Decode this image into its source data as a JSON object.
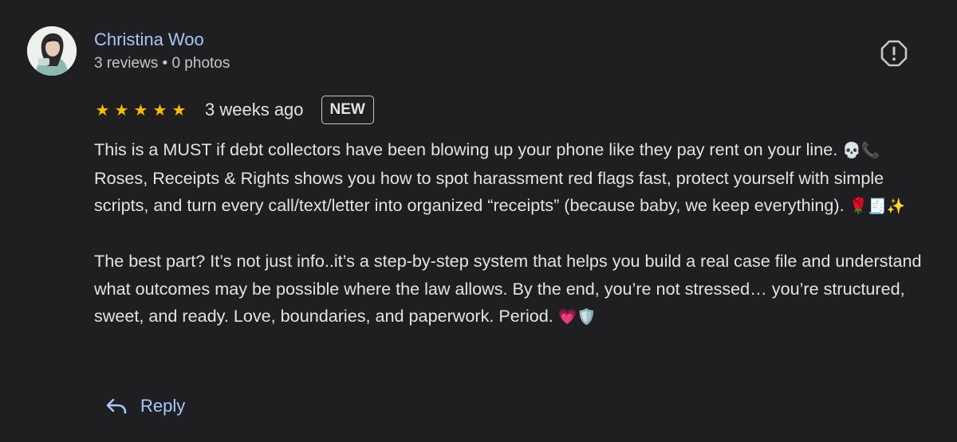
{
  "author": {
    "name": "Christina Woo",
    "meta": "3 reviews • 0 photos",
    "avatar_icon": "profile-photo"
  },
  "report": {
    "icon": "report-icon"
  },
  "rating": {
    "stars": 5,
    "max": 5,
    "star_color": "#fbbc04",
    "date": "3 weeks ago",
    "badge": "NEW"
  },
  "review": {
    "paragraph1_part1": "This is a MUST if debt collectors have been blowing up your phone like they pay rent on your line. ",
    "paragraph1_emoji1": "💀📞",
    "paragraph1_part2": " Roses, Receipts & Rights shows you how to spot harassment red flags fast, protect yourself with simple scripts, and turn every call/text/letter into organized “receipts” (because baby, we keep everything). ",
    "paragraph1_emoji2": "🌹🧾✨",
    "paragraph2_part1": "The best part? It’s not just info..it’s a step-by-step system that helps you build a real case file and understand what outcomes may be possible where the law allows. By the end, you’re not stressed… you’re structured, sweet, and ready. Love, boundaries, and paperwork. Period. ",
    "paragraph2_emoji": "💗🛡️"
  },
  "actions": {
    "reply_label": "Reply",
    "accent_color": "#a8c7fa"
  }
}
